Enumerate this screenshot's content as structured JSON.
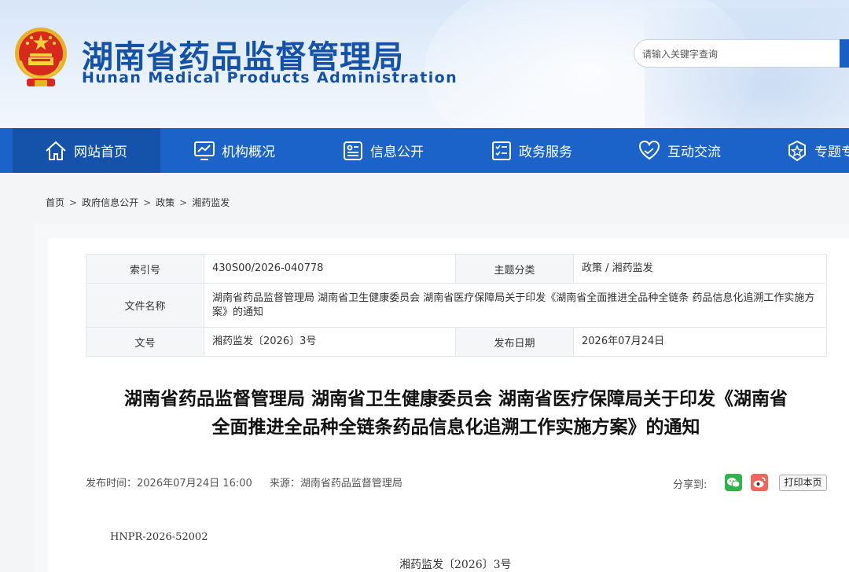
{
  "site": {
    "title": "湖南省药品监督管理局",
    "subtitle": "Hunan Medical Products Administration"
  },
  "search": {
    "placeholder": "请输入关键字查询"
  },
  "nav": [
    {
      "label": "网站首页",
      "icon": "home-icon"
    },
    {
      "label": "机构概况",
      "icon": "monitor-chart-icon"
    },
    {
      "label": "信息公开",
      "icon": "info-card-icon"
    },
    {
      "label": "政务服务",
      "icon": "checklist-icon"
    },
    {
      "label": "互动交流",
      "icon": "heart-hands-icon"
    },
    {
      "label": "专题专栏",
      "icon": "star-badge-icon"
    }
  ],
  "breadcrumb": [
    "首页",
    "政府信息公开",
    "政策",
    "湘药监发"
  ],
  "breadcrumb_sep": ">",
  "meta": {
    "index_label": "索引号",
    "index_value": "430S00/2026-040778",
    "topic_label": "主题分类",
    "topic_value": "政策 / 湘药监发",
    "filename_label": "文件名称",
    "filename_value": "湖南省药品监督管理局 湖南省卫生健康委员会 湖南省医疗保障局关于印发《湖南省全面推进全品种全链条 药品信息化追溯工作实施方案》的通知",
    "docno_label": "文号",
    "docno_value": "湘药监发〔2026〕3号",
    "date_label": "发布日期",
    "date_value": "2026年07月24日"
  },
  "article": {
    "title_line1": "湖南省药品监督管理局 湖南省卫生健康委员会 湖南省医疗保障局关于印发《湖南省",
    "title_line2": "全面推进全品种全链条药品信息化追溯工作实施方案》的通知",
    "publish_time": "发布时间：2026年07月24日 16:00",
    "source": "来源：湖南省药品监督管理局",
    "share_label": "分享到:",
    "print_label": "打印本页",
    "code": "HNPR-2026-52002",
    "doc_number": "湘药监发〔2026〕3号"
  },
  "colors": {
    "brand_blue": "#1451a8",
    "nav_bg": "#1b63c8",
    "nav_active": "#1552aa",
    "wechat_green": "#31b34b",
    "weibo_red": "#f0665b"
  }
}
